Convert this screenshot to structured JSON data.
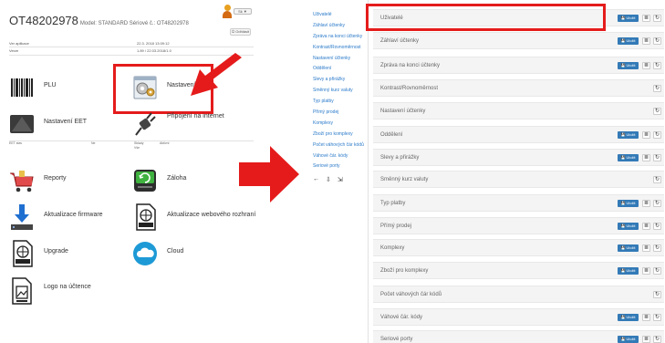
{
  "left": {
    "title": "OT48202978",
    "subtitle": "Model: STANDARD Sériové č.: OT48202978",
    "badge": "Sk",
    "connect_button": "Odhlásit",
    "info": [
      {
        "k": "Ver aplikace",
        "v": "22.3. 2018 13:09:12"
      },
      {
        "k": "Verze",
        "v": "1.89 / 22.03.2018/1.0"
      }
    ],
    "tiles": [
      {
        "label": "PLU",
        "icon": "barcode-icon"
      },
      {
        "label": "Nastavení",
        "icon": "settings-window-icon"
      },
      {
        "label": "Nastavení EET",
        "icon": "eet-icon"
      },
      {
        "label": "Připojení na internet",
        "icon": "internet-plug-icon"
      },
      {
        "label": "Reporty",
        "icon": "shopping-cart-icon"
      },
      {
        "label": "Záloha",
        "icon": "backup-icon"
      },
      {
        "label": "Aktualizace firmware",
        "icon": "download-icon"
      },
      {
        "label": "Aktualizace webového rozhraní",
        "icon": "html-file-icon"
      },
      {
        "label": "Upgrade",
        "icon": "html-file-icon"
      },
      {
        "label": "Cloud",
        "icon": "cloud-icon"
      },
      {
        "label": "Logo na účtence",
        "icon": "image-file-icon"
      }
    ],
    "meta_left": [
      "EET stav",
      "Ne"
    ],
    "meta_right": [
      "Sklady",
      "Aktivní",
      "Vše"
    ]
  },
  "nav": {
    "items": [
      "Uživatelé",
      "Záhlaví účtenky",
      "Zpráva na konci účtenky",
      "Kontrast/Rovnoměrnost",
      "Nastavení účtenky",
      "Oddělení",
      "Slevy a přirážky",
      "Směnný kurz valuty",
      "Typ platby",
      "Přímý prodej",
      "Komplexy",
      "Zboží pro komplexy",
      "Počet váhových čár kódů",
      "Váhové čár. kódy",
      "Seriové porty"
    ],
    "tools": [
      "←",
      "⇩",
      "⇲"
    ]
  },
  "list": {
    "save_label": "Uložit",
    "rows": [
      {
        "label": "Uživatelé",
        "save": true
      },
      {
        "label": "Záhlaví účtenky",
        "save": true
      },
      {
        "label": "Zpráva na konci účtenky",
        "save": true
      },
      {
        "label": "Kontrast/Rovnoměrnost",
        "save": false
      },
      {
        "label": "Nastavení účtenky",
        "save": false
      },
      {
        "label": "Oddělení",
        "save": true
      },
      {
        "label": "Slevy a přirážky",
        "save": true
      },
      {
        "label": "Směnný kurz valuty",
        "save": false
      },
      {
        "label": "Typ platby",
        "save": true
      },
      {
        "label": "Přímý prodej",
        "save": true
      },
      {
        "label": "Komplexy",
        "save": true
      },
      {
        "label": "Zboží pro komplexy",
        "save": true
      },
      {
        "label": "Počet váhových čár kódů",
        "save": false
      },
      {
        "label": "Váhové čár. kódy",
        "save": true
      },
      {
        "label": "Seriové porty",
        "save": true
      }
    ]
  },
  "colors": {
    "highlight": "#e51b1b",
    "primary": "#337ab7",
    "link": "#2a7ac9"
  }
}
